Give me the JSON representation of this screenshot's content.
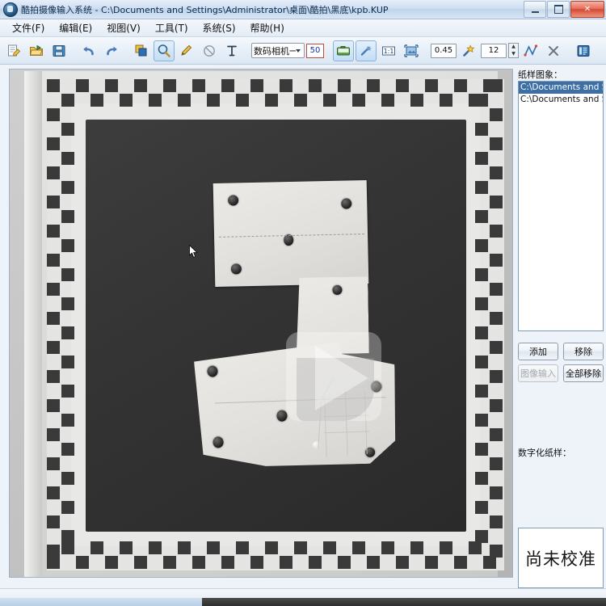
{
  "window": {
    "title": "酷拍摄像输入系统 - C:\\Documents and Settings\\Administrator\\桌面\\酷拍\\黑底\\kpb.KUP",
    "app_icon": "camera-app-icon",
    "minimize_label": "",
    "maximize_label": "",
    "close_label": "✕"
  },
  "menubar": {
    "items": [
      {
        "label": "文件(F)",
        "name": "menu-file"
      },
      {
        "label": "编辑(E)",
        "name": "menu-edit"
      },
      {
        "label": "视图(V)",
        "name": "menu-view"
      },
      {
        "label": "工具(T)",
        "name": "menu-tools"
      },
      {
        "label": "系统(S)",
        "name": "menu-system"
      },
      {
        "label": "帮助(H)",
        "name": "menu-help"
      }
    ]
  },
  "toolbar": {
    "camera_select": "数码相机一",
    "threshold_value": "50",
    "scale_value": "0.45",
    "count_value": "12",
    "icons": [
      "new-document-icon",
      "open-folder-icon",
      "save-disk-icon",
      "undo-arrow-icon",
      "redo-arrow-icon",
      "layers-icon",
      "magnifier-icon",
      "pencil-icon",
      "no-entry-icon",
      "text-tool-icon",
      "image-capture-icon",
      "wand-icon",
      "one-to-one-zoom-icon",
      "fit-image-icon",
      "marker-wand-icon",
      "spinner-icon",
      "polyline-icon",
      "delete-x-icon",
      "properties-panel-icon"
    ]
  },
  "right_panel": {
    "images_label": "纸样图象：",
    "image_list": [
      {
        "text": "C:\\Documents and Setti",
        "selected": true
      },
      {
        "text": "C:\\Documents and Setti",
        "selected": false
      }
    ],
    "buttons": {
      "add": "添加",
      "remove": "移除",
      "image_input": "图像输入",
      "remove_all": "全部移除"
    },
    "digitized_label": "数字化纸样：",
    "digitized_status": "尚未校准"
  },
  "canvas": {
    "description": "black calibration mat with checkerboard border and two white pattern pieces",
    "video_overlay": "play-button-overlay",
    "cursor": "arrow-cursor"
  },
  "colors": {
    "accent": "#3d6fa5",
    "title_bar": "#cfdef1",
    "mat_dark": "#343434",
    "piece_white": "#e6e4e0"
  }
}
